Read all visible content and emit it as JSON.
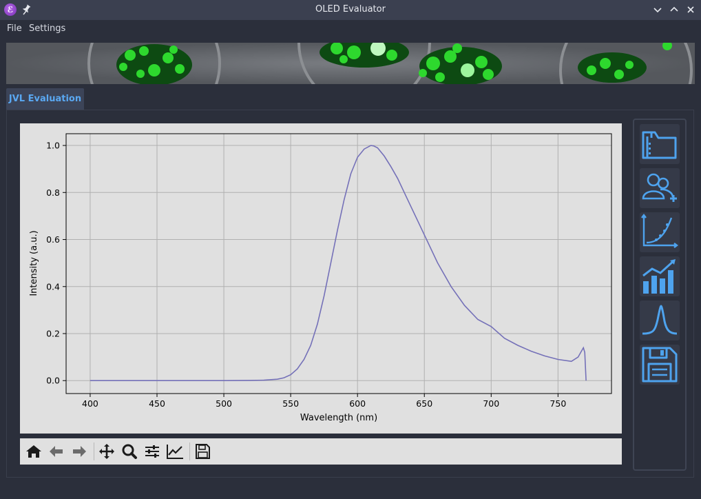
{
  "window": {
    "title": "OLED Evaluator",
    "icon_letter": "ℰ"
  },
  "menu": {
    "items": [
      "File",
      "Settings"
    ]
  },
  "tabs": [
    {
      "label": "JVL Evaluation",
      "active": true
    }
  ],
  "colors": {
    "accent": "#5aa8f2",
    "curve": "#7470b8",
    "plot_bg": "#e0e0e0",
    "window_bg": "#2b2f3b"
  },
  "nav_toolbar": {
    "buttons": [
      "home-icon",
      "back-icon",
      "forward-icon",
      "pan-icon",
      "zoom-icon",
      "configure-subplots-icon",
      "edit-axis-icon",
      "save-figure-icon"
    ]
  },
  "sidebar": {
    "buttons": [
      "folder-icon",
      "add-user-icon",
      "curve-fit-icon",
      "bar-chart-trend-icon",
      "spectrum-peak-icon",
      "save-icon"
    ]
  },
  "chart_data": {
    "type": "line",
    "xlabel": "Wavelength (nm)",
    "ylabel": "Intensity (a.u.)",
    "xlim": [
      382,
      790
    ],
    "ylim": [
      -0.055,
      1.05
    ],
    "xticks": [
      400,
      450,
      500,
      550,
      600,
      650,
      700,
      750
    ],
    "xtick_labels": [
      "400",
      "450",
      "500",
      "550",
      "600",
      "650",
      "700",
      "750"
    ],
    "yticks": [
      0.0,
      0.2,
      0.4,
      0.6,
      0.8,
      1.0
    ],
    "ytick_labels": [
      "0.0",
      "0.2",
      "0.4",
      "0.6",
      "0.8",
      "1.0"
    ],
    "grid": true,
    "series": [
      {
        "x": [
          400,
          450,
          500,
          520,
          530,
          540,
          545,
          550,
          555,
          560,
          565,
          570,
          575,
          580,
          585,
          590,
          595,
          600,
          605,
          610,
          612,
          615,
          620,
          625,
          630,
          635,
          640,
          645,
          650,
          660,
          670,
          680,
          690,
          700,
          710,
          720,
          730,
          740,
          750,
          760,
          765,
          768,
          769,
          770,
          771
        ],
        "y": [
          0.0,
          0.0,
          0.0,
          0.001,
          0.002,
          0.006,
          0.012,
          0.025,
          0.05,
          0.09,
          0.15,
          0.24,
          0.36,
          0.5,
          0.64,
          0.77,
          0.88,
          0.95,
          0.985,
          1.0,
          0.998,
          0.99,
          0.955,
          0.91,
          0.86,
          0.8,
          0.74,
          0.68,
          0.62,
          0.5,
          0.4,
          0.32,
          0.26,
          0.23,
          0.18,
          0.15,
          0.125,
          0.105,
          0.09,
          0.082,
          0.1,
          0.13,
          0.14,
          0.12,
          0.0
        ]
      }
    ]
  }
}
